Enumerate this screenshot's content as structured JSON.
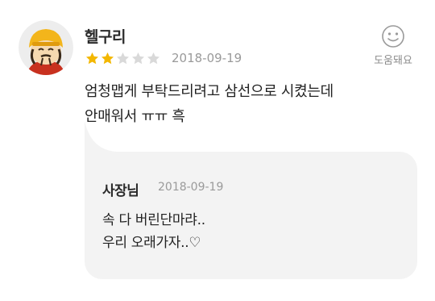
{
  "review": {
    "username": "헬구리",
    "rating": 2,
    "max_rating": 5,
    "date": "2018-09-19",
    "text": "엄청맵게 부탁드리려고 삼선으로 시켰는데\n안매워서 ㅠㅠ 흑",
    "helpful_label": "도움돼요"
  },
  "reply": {
    "owner_label": "사장님",
    "date": "2018-09-19",
    "text": "속 다 버린단마랴..\n우리 오래가자..♡"
  },
  "colors": {
    "star_filled": "#f3b700",
    "star_empty": "#d9d9d9",
    "reply_bg": "#f3f3f3"
  }
}
